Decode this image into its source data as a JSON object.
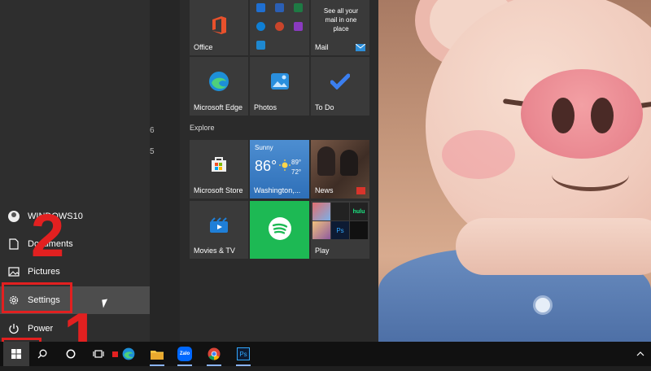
{
  "left_rail": {
    "user": "WINDOWS10",
    "documents": "Documents",
    "pictures": "Pictures",
    "settings": "Settings",
    "power": "Power"
  },
  "applist_letters": [
    "6",
    "5"
  ],
  "tiles": {
    "office": "Office",
    "mail": "Mail",
    "mail_promo": "See all your mail in one place",
    "edge": "Microsoft Edge",
    "photos": "Photos",
    "todo": "To Do",
    "explore_header": "Explore",
    "store": "Microsoft Store",
    "weather": {
      "condition": "Sunny",
      "temp": "86°",
      "high": "89°",
      "low": "72°",
      "location": "Washington,..."
    },
    "news": "News",
    "movies": "Movies & TV",
    "play": "Play",
    "hulu": "hulu",
    "ps": "Ps"
  },
  "annotations": {
    "step1": "1",
    "step2": "2"
  },
  "taskbar": {
    "zalo_label": "Zalo",
    "ps_label": "Ps"
  },
  "colors": {
    "annotation_red": "#e22020",
    "spotify_green": "#1db954",
    "tile_blue": "#2d7fc1"
  }
}
